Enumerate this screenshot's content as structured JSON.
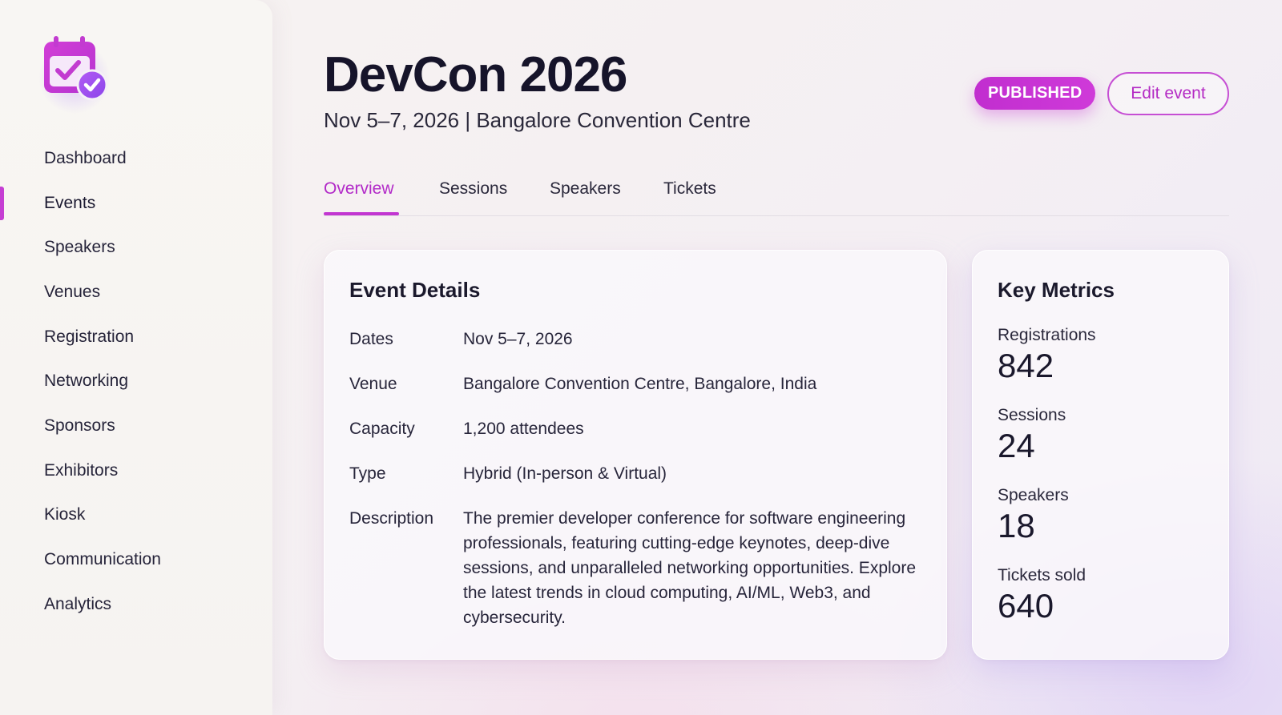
{
  "sidebar": {
    "logo_icon": "calendar-check-icon",
    "items": [
      {
        "label": "Dashboard",
        "active": false
      },
      {
        "label": "Events",
        "active": true
      },
      {
        "label": "Speakers",
        "active": false
      },
      {
        "label": "Venues",
        "active": false
      },
      {
        "label": "Registration",
        "active": false
      },
      {
        "label": "Networking",
        "active": false
      },
      {
        "label": "Sponsors",
        "active": false
      },
      {
        "label": "Exhibitors",
        "active": false
      },
      {
        "label": "Kiosk",
        "active": false
      },
      {
        "label": "Communication",
        "active": false
      },
      {
        "label": "Analytics",
        "active": false
      }
    ]
  },
  "header": {
    "title": "DevCon 2026",
    "subtitle": "Nov 5–7, 2026 | Bangalore Convention Centre",
    "status": "PUBLISHED",
    "edit_label": "Edit event"
  },
  "tabs": [
    {
      "label": "Overview",
      "active": true
    },
    {
      "label": "Sessions",
      "active": false
    },
    {
      "label": "Speakers",
      "active": false
    },
    {
      "label": "Tickets",
      "active": false
    }
  ],
  "details": {
    "title": "Event Details",
    "rows": [
      {
        "label": "Dates",
        "value": "Nov 5–7, 2026"
      },
      {
        "label": "Venue",
        "value": "Bangalore Convention Centre, Bangalore, India"
      },
      {
        "label": "Capacity",
        "value": "1,200 attendees"
      },
      {
        "label": "Type",
        "value": "Hybrid (In-person & Virtual)"
      },
      {
        "label": "Description",
        "value": "The premier developer conference for software engineering professionals, featuring cutting-edge keynotes, deep-dive sessions, and unparalleled networking opportunities. Explore the latest trends in cloud computing, AI/ML, Web3, and cybersecurity."
      }
    ]
  },
  "metrics": {
    "title": "Key Metrics",
    "items": [
      {
        "label": "Registrations",
        "value": "842"
      },
      {
        "label": "Sessions",
        "value": "24"
      },
      {
        "label": "Speakers",
        "value": "18"
      },
      {
        "label": "Tickets sold",
        "value": "640"
      }
    ]
  },
  "colors": {
    "accent": "#c236d1",
    "accent_text": "#b22ac8",
    "logo_primary": "#c93cd4",
    "logo_secondary": "#9b4cf0"
  }
}
